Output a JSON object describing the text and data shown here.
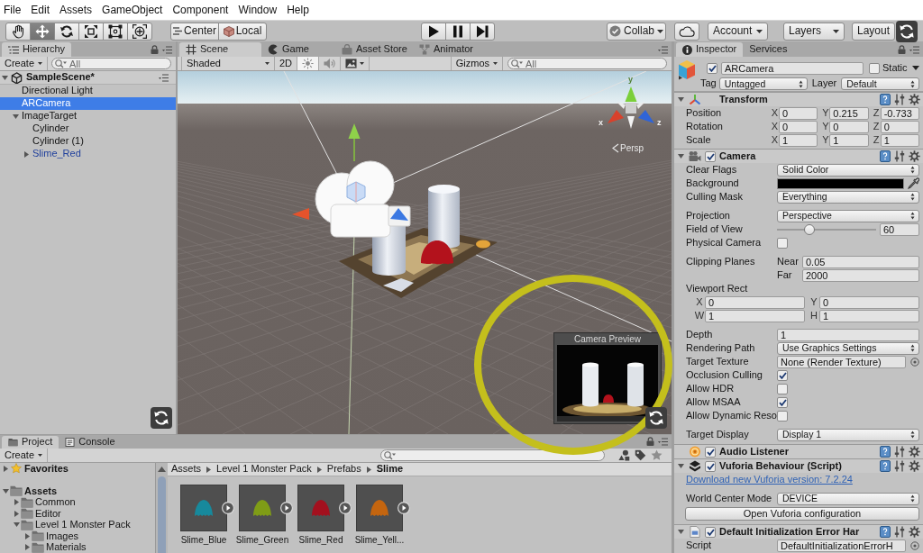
{
  "menu": [
    "File",
    "Edit",
    "Assets",
    "GameObject",
    "Component",
    "Window",
    "Help"
  ],
  "toolbar": {
    "tools": [
      {
        "kind": "hand",
        "selected": false
      },
      {
        "kind": "move",
        "selected": true
      },
      {
        "kind": "rotate",
        "selected": false
      },
      {
        "kind": "scale",
        "selected": false
      },
      {
        "kind": "rect",
        "selected": false
      },
      {
        "kind": "transform",
        "selected": false
      }
    ],
    "pivot": [
      {
        "kind": "center",
        "label": "Center"
      },
      {
        "kind": "local",
        "label": "Local"
      }
    ],
    "playback": [
      {
        "kind": "play"
      },
      {
        "kind": "pause"
      },
      {
        "kind": "step"
      }
    ],
    "collab": "Collab",
    "account": "Account",
    "layers": "Layers",
    "layout": "Layout"
  },
  "hierarchy": {
    "tab": "Hierarchy",
    "create": "Create",
    "search": {
      "placeholder": "All"
    },
    "scene": {
      "label": "SampleScene*",
      "expanded": true
    },
    "items": [
      {
        "label": "Directional Light",
        "selected": false,
        "prefab": false
      },
      {
        "label": "ARCamera",
        "selected": true,
        "prefab": false
      },
      {
        "label": "ImageTarget",
        "selected": false,
        "prefab": false,
        "expanded": true,
        "children": [
          {
            "label": "Cylinder",
            "selected": false,
            "prefab": false
          },
          {
            "label": "Cylinder (1)",
            "selected": false,
            "prefab": false
          },
          {
            "label": "Slime_Red",
            "selected": false,
            "prefab": true,
            "expanded": false
          }
        ]
      }
    ]
  },
  "scene_view": {
    "tabs": [
      {
        "kind": "scene",
        "label": "Scene",
        "selected": true
      },
      {
        "kind": "game",
        "label": "Game",
        "selected": false
      },
      {
        "kind": "store",
        "label": "Asset Store",
        "selected": false
      },
      {
        "kind": "animator",
        "label": "Animator",
        "selected": false
      }
    ],
    "shading": "Shaded",
    "toggles": [
      {
        "kind": "dimension",
        "label": "2D",
        "on": false
      },
      {
        "kind": "lighting",
        "on": true
      },
      {
        "kind": "audio",
        "on": false
      },
      {
        "kind": "effects",
        "on": false
      }
    ],
    "gizmos": "Gizmos",
    "search": {
      "placeholder": "All"
    },
    "axis_labels": [
      "y",
      "x",
      "z"
    ],
    "projection": "Persp",
    "camera_preview": {
      "title": "Camera Preview"
    }
  },
  "inspector": {
    "tabs": [
      {
        "kind": "inspector",
        "label": "Inspector",
        "selected": true
      },
      {
        "kind": "services",
        "label": "Services",
        "selected": false
      }
    ],
    "object": {
      "active": true,
      "name": "ARCamera",
      "static": false,
      "static_label": "Static",
      "tag_label": "Tag",
      "tag": "Untagged",
      "layer_label": "Layer",
      "layer": "Default"
    },
    "components": [
      {
        "kind": "transform",
        "title": "Transform",
        "expanded": true,
        "rows": [
          {
            "label": "Position",
            "fields": [
              {
                "axis": "X",
                "value": "0"
              },
              {
                "axis": "Y",
                "value": "0.215"
              },
              {
                "axis": "Z",
                "value": "-0.733"
              }
            ]
          },
          {
            "label": "Rotation",
            "fields": [
              {
                "axis": "X",
                "value": "0"
              },
              {
                "axis": "Y",
                "value": "0"
              },
              {
                "axis": "Z",
                "value": "0"
              }
            ]
          },
          {
            "label": "Scale",
            "fields": [
              {
                "axis": "X",
                "value": "1"
              },
              {
                "axis": "Y",
                "value": "1"
              },
              {
                "axis": "Z",
                "value": "1"
              }
            ]
          }
        ]
      },
      {
        "kind": "camera",
        "title": "Camera",
        "expanded": true,
        "enabled": true,
        "groups": [
          [
            {
              "kind": "dropdown",
              "label": "Clear Flags",
              "value": "Solid Color"
            },
            {
              "kind": "color",
              "label": "Background",
              "color": "#000000"
            },
            {
              "kind": "dropdown",
              "label": "Culling Mask",
              "value": "Everything"
            }
          ],
          [
            {
              "kind": "dropdown",
              "label": "Projection",
              "value": "Perspective"
            },
            {
              "kind": "slider",
              "label": "Field of View",
              "level": 0.33,
              "value": "60"
            },
            {
              "kind": "checkbox",
              "label": "Physical Camera",
              "checked": false
            }
          ],
          [
            {
              "kind": "pairs",
              "label": "Clipping Planes",
              "fields": [
                {
                  "label": "Near",
                  "value": "0.05"
                },
                {
                  "label": "Far",
                  "value": "2000"
                }
              ]
            },
            {
              "kind": "rect",
              "label": "Viewport Rect",
              "fields": [
                {
                  "label": "X",
                  "value": "0"
                },
                {
                  "label": "Y",
                  "value": "0"
                },
                {
                  "label": "W",
                  "value": "1"
                },
                {
                  "label": "H",
                  "value": "1"
                }
              ]
            }
          ],
          [
            {
              "kind": "text",
              "label": "Depth",
              "value": "1"
            },
            {
              "kind": "dropdown",
              "label": "Rendering Path",
              "value": "Use Graphics Settings"
            },
            {
              "kind": "object",
              "label": "Target Texture",
              "value": "None (Render Texture)"
            },
            {
              "kind": "checkbox",
              "label": "Occlusion Culling",
              "checked": true
            },
            {
              "kind": "checkbox",
              "label": "Allow HDR",
              "checked": false
            },
            {
              "kind": "checkbox",
              "label": "Allow MSAA",
              "checked": true
            },
            {
              "kind": "checkbox",
              "label": "Allow Dynamic Reso",
              "checked": false
            }
          ],
          [
            {
              "kind": "dropdown",
              "label": "Target Display",
              "value": "Display 1"
            }
          ]
        ]
      },
      {
        "kind": "audio_listener",
        "title": "Audio Listener",
        "enabled": true
      },
      {
        "kind": "vuforia",
        "title": "Vuforia Behaviour (Script)",
        "expanded": true,
        "enabled": true,
        "groups": [
          [
            {
              "kind": "link",
              "text": "Download new Vuforia version: 7.2.24"
            }
          ],
          [
            {
              "kind": "dropdown",
              "label": "World Center Mode",
              "value": "DEVICE"
            },
            {
              "kind": "button",
              "label": "Open Vuforia configuration"
            }
          ]
        ]
      },
      {
        "kind": "script",
        "title": "Default Initialization Error Har",
        "expanded": true,
        "enabled": true,
        "groups": [
          [
            {
              "kind": "object",
              "label": "Script",
              "value": "DefaultInitializationErrorH"
            }
          ]
        ]
      }
    ]
  },
  "project": {
    "tabs": [
      {
        "kind": "project",
        "label": "Project",
        "selected": true
      },
      {
        "kind": "console",
        "label": "Console",
        "selected": false
      }
    ],
    "create": "Create",
    "tree": [
      {
        "kind": "favorites",
        "label": "Favorites",
        "expanded": false
      },
      {
        "kind": "folder",
        "label": "Assets",
        "expanded": true,
        "children": [
          {
            "kind": "folder",
            "label": "Common",
            "expanded": false
          },
          {
            "kind": "folder",
            "label": "Editor",
            "expanded": false
          },
          {
            "kind": "folder",
            "label": "Level 1 Monster Pack",
            "expanded": true,
            "children": [
              {
                "kind": "folder",
                "label": "Images",
                "expanded": false
              },
              {
                "kind": "folder",
                "label": "Materials",
                "expanded": false
              }
            ]
          }
        ]
      }
    ],
    "breadcrumb": [
      "Assets",
      "Level 1 Monster Pack",
      "Prefabs",
      "Slime"
    ],
    "assets": [
      {
        "label": "Slime_Blue",
        "color": "#17899c"
      },
      {
        "label": "Slime_Green",
        "color": "#7f9c16"
      },
      {
        "label": "Slime_Red",
        "color": "#a3101e"
      },
      {
        "label": "Slime_Yell...",
        "color": "#c4650f"
      }
    ]
  }
}
